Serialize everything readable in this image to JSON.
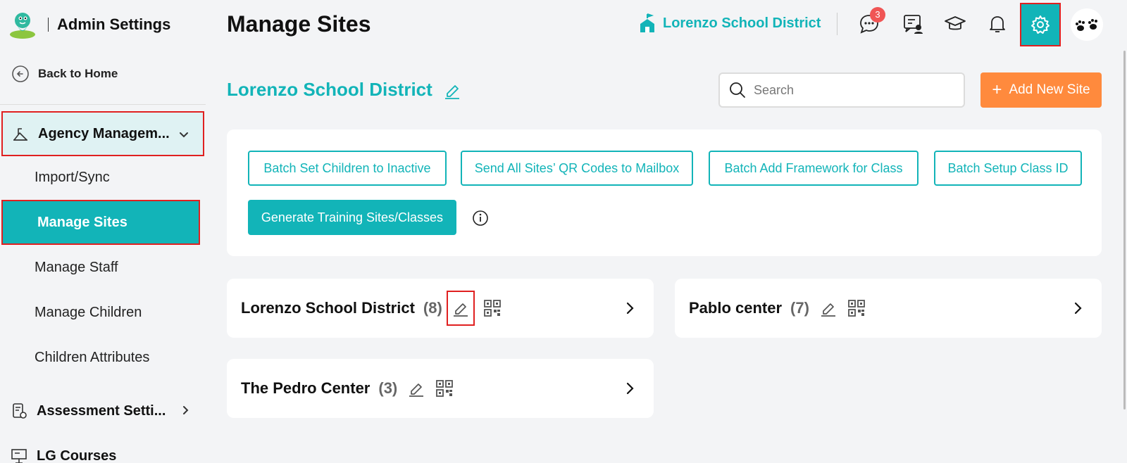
{
  "brand": {
    "title": "Admin Settings",
    "logo_icon": "frog-logo-icon"
  },
  "sidebar": {
    "back_label": "Back to Home",
    "groups": [
      {
        "label": "Agency Managem...",
        "icon": "agency-icon",
        "expanded": true
      },
      {
        "label": "Assessment Setti...",
        "icon": "assessment-settings-icon",
        "expanded": false
      },
      {
        "label": "LG Courses",
        "icon": "courses-icon"
      }
    ],
    "items": [
      "Import/Sync",
      "Manage Sites",
      "Manage Staff",
      "Manage Children",
      "Children Attributes"
    ],
    "active_item": "Manage Sites"
  },
  "header": {
    "page_title": "Manage Sites",
    "agency_name": "Lorenzo School District",
    "message_badge": "3"
  },
  "main": {
    "district_title": "Lorenzo School District",
    "search_placeholder": "Search",
    "add_button": "Add New Site",
    "batch_buttons": [
      "Batch Set Children to Inactive",
      "Send All Sites’ QR Codes to Mailbox",
      "Batch Add Framework for Class",
      "Batch Setup Class ID"
    ],
    "generate_button": "Generate Training Sites/Classes",
    "sites": [
      {
        "name": "Lorenzo School District",
        "count": "(8)"
      },
      {
        "name": "Pablo center",
        "count": "(7)"
      },
      {
        "name": "The Pedro Center",
        "count": "(3)"
      }
    ]
  },
  "colors": {
    "accent": "#12b4b8",
    "orange": "#ff8a3d",
    "highlight": "#e02020",
    "badge": "#f05555"
  }
}
